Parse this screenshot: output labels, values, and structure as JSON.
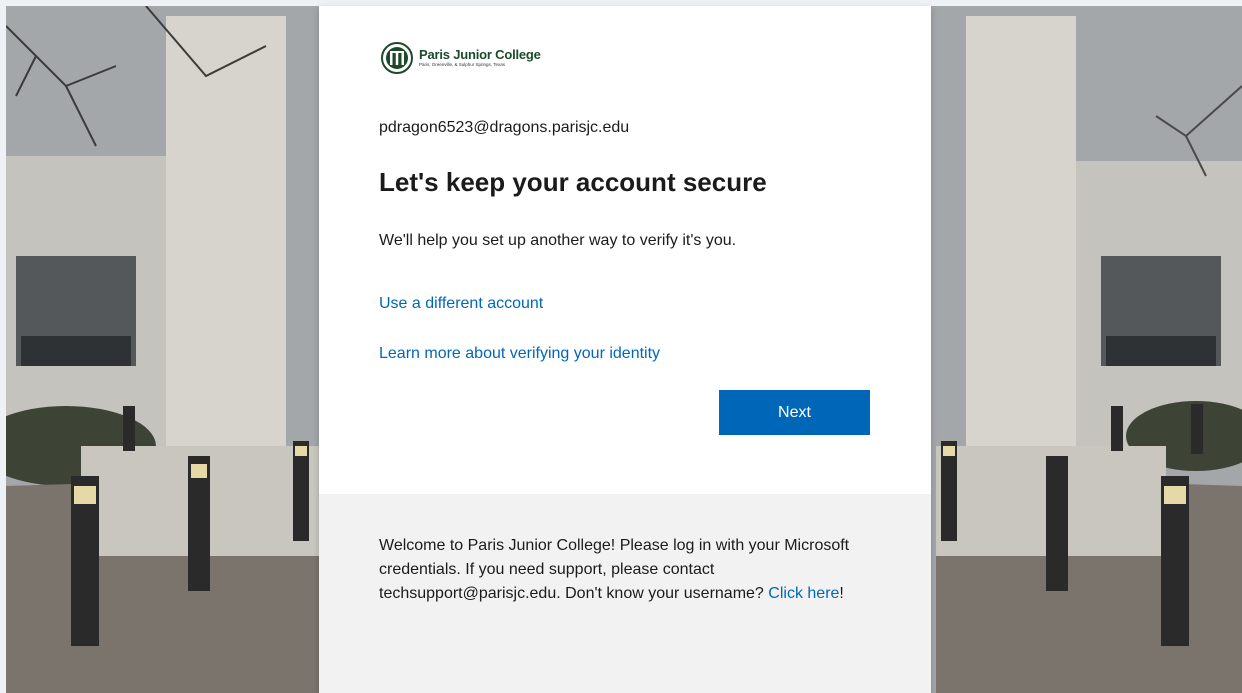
{
  "brand": {
    "name": "Paris Junior College",
    "tagline": "Paris, Greenville, & Sulphur Springs, Texas",
    "seal_letters": "PJC",
    "color": "#1d4a2a"
  },
  "account": {
    "email": "pdragon6523@dragons.parisjc.edu"
  },
  "main": {
    "title": "Let's keep your account secure",
    "description": "We'll help you set up another way to verify it's you.",
    "link_different_account": "Use a different account",
    "link_learn_more": "Learn more about verifying your identity",
    "next_label": "Next"
  },
  "footer": {
    "text_before_link": "Welcome to Paris Junior College! Please log in with your Microsoft credentials. If you need support, please contact techsupport@parisjc.edu. Don't know your username? ",
    "link_text": "Click here",
    "text_after_link": "!"
  },
  "colors": {
    "accent": "#0067b8",
    "footer_bg": "#f2f2f2",
    "text": "#1b1b1b"
  }
}
